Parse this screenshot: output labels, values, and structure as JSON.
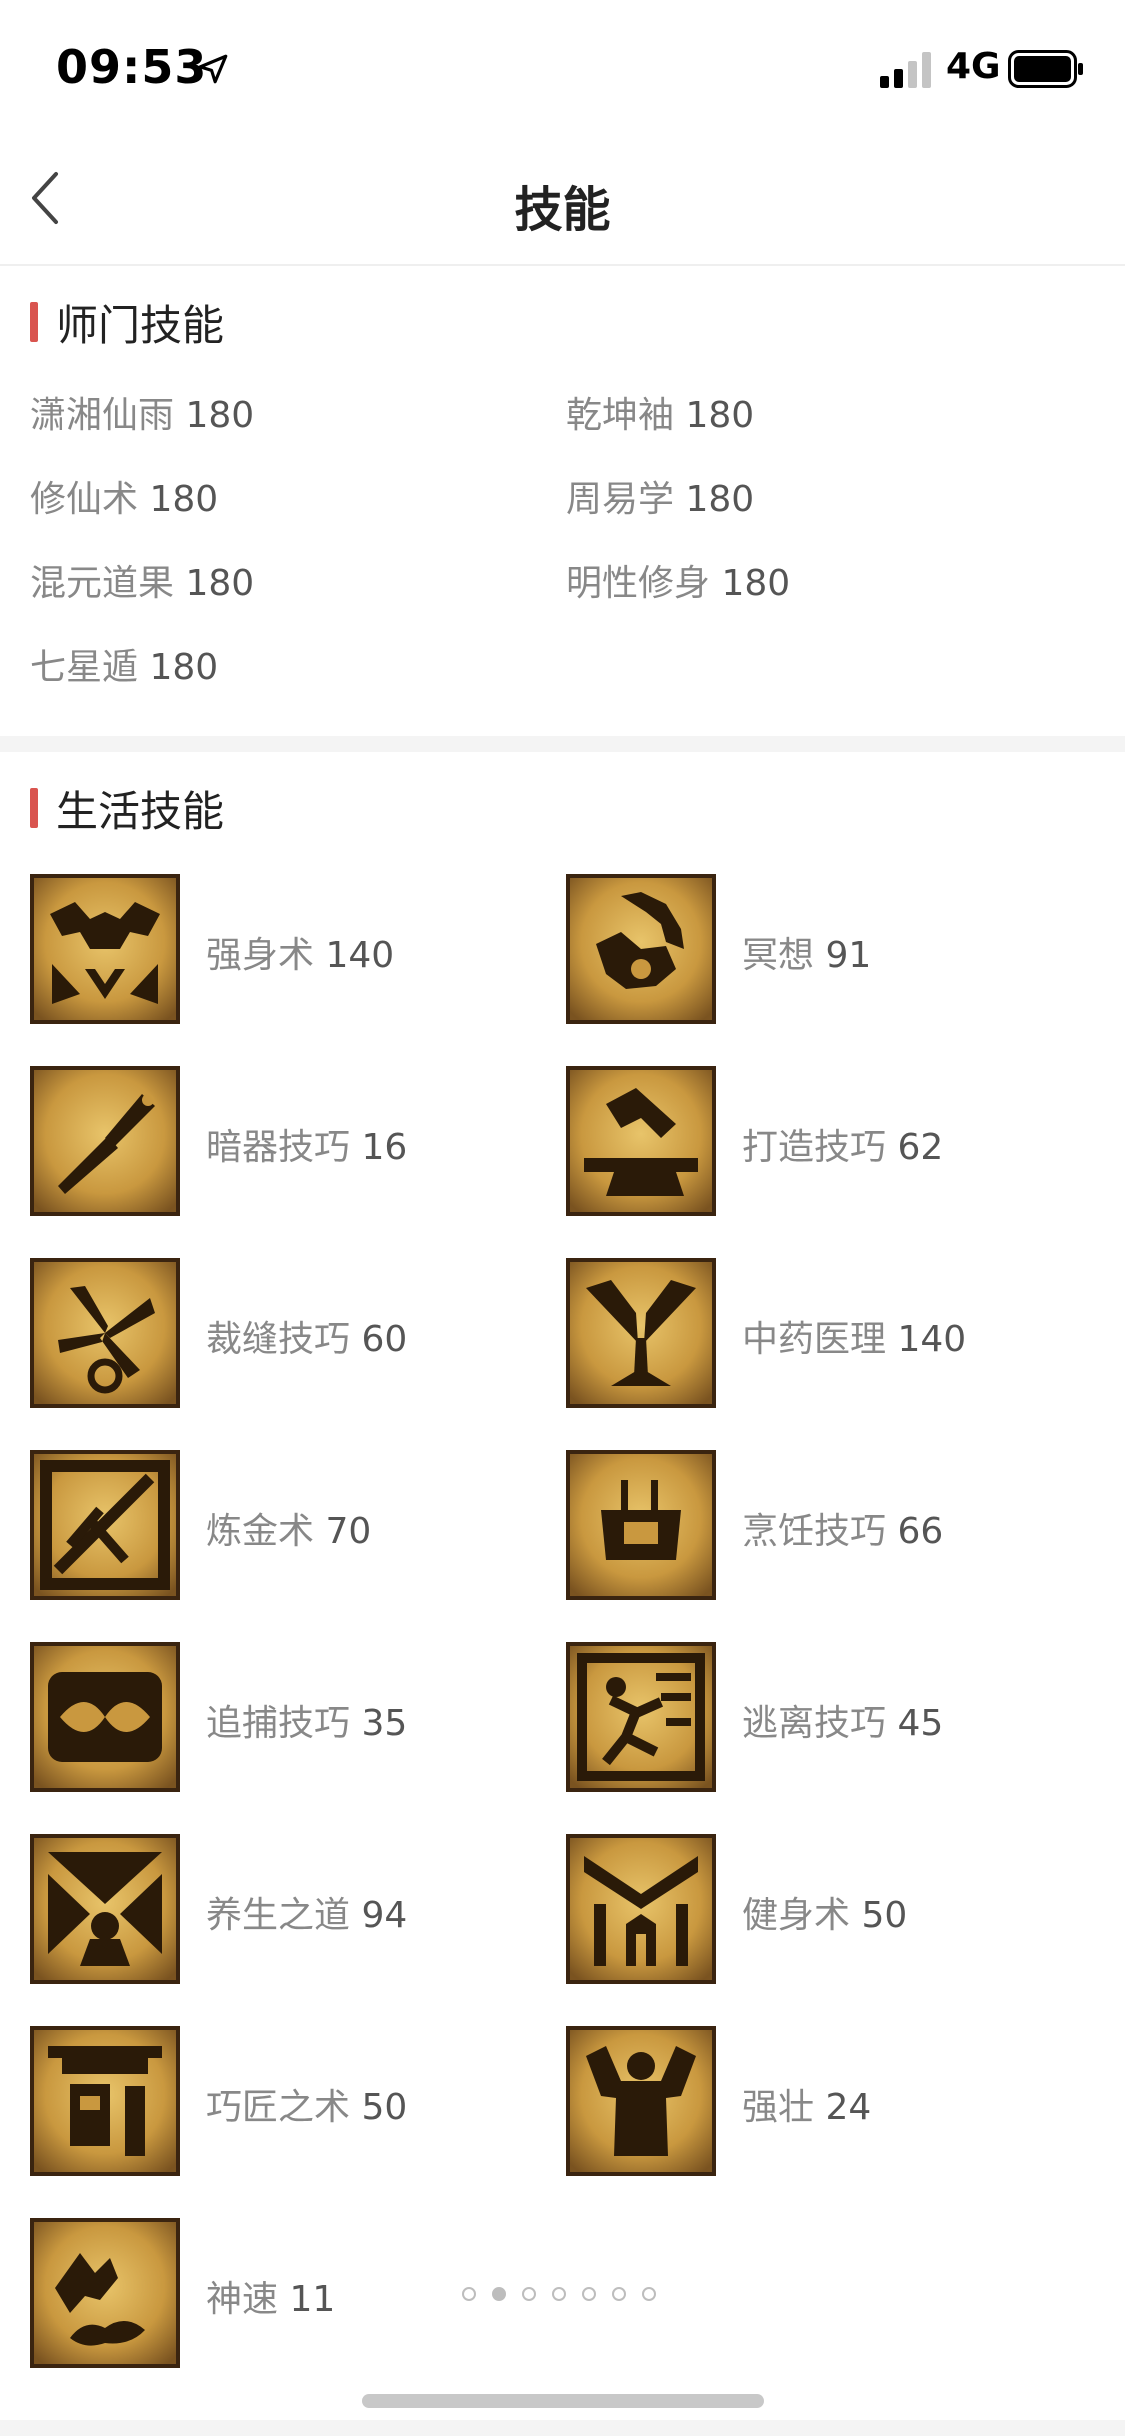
{
  "status_bar": {
    "time": "09:53",
    "network": "4G",
    "icons": [
      "location-arrow-icon",
      "signal-icon",
      "battery-icon"
    ]
  },
  "nav": {
    "title": "技能",
    "back_icon": "chevron-left-icon"
  },
  "school_skills": {
    "title": "师门技能",
    "items": [
      {
        "name": "潇湘仙雨",
        "level": "180"
      },
      {
        "name": "乾坤袖",
        "level": "180"
      },
      {
        "name": "修仙术",
        "level": "180"
      },
      {
        "name": "周易学",
        "level": "180"
      },
      {
        "name": "混元道果",
        "level": "180"
      },
      {
        "name": "明性修身",
        "level": "180"
      },
      {
        "name": "七星遁",
        "level": "180"
      }
    ]
  },
  "life_skills": {
    "title": "生活技能",
    "items": [
      {
        "name": "强身术",
        "level": "140",
        "icon": "strength-icon"
      },
      {
        "name": "冥想",
        "level": "91",
        "icon": "meditation-icon"
      },
      {
        "name": "暗器技巧",
        "level": "16",
        "icon": "dart-icon"
      },
      {
        "name": "打造技巧",
        "level": "62",
        "icon": "anvil-hammer-icon"
      },
      {
        "name": "裁缝技巧",
        "level": "60",
        "icon": "scissors-icon"
      },
      {
        "name": "中药医理",
        "level": "140",
        "icon": "herb-icon"
      },
      {
        "name": "炼金术",
        "level": "70",
        "icon": "alchemy-icon"
      },
      {
        "name": "烹饪技巧",
        "level": "66",
        "icon": "cooking-pot-icon"
      },
      {
        "name": "追捕技巧",
        "level": "35",
        "icon": "chase-icon"
      },
      {
        "name": "逃离技巧",
        "level": "45",
        "icon": "escape-icon"
      },
      {
        "name": "养生之道",
        "level": "94",
        "icon": "health-icon"
      },
      {
        "name": "健身术",
        "level": "50",
        "icon": "fitness-icon"
      },
      {
        "name": "巧匠之术",
        "level": "50",
        "icon": "craftsman-icon"
      },
      {
        "name": "强壮",
        "level": "24",
        "icon": "muscle-icon"
      },
      {
        "name": "神速",
        "level": "11",
        "icon": "speed-icon"
      }
    ]
  },
  "pagination": {
    "total": 7,
    "active_index": 1
  },
  "colors": {
    "accent": "#d9544f",
    "icon_gold": "#c9983f",
    "icon_dark": "#2a1a08"
  }
}
